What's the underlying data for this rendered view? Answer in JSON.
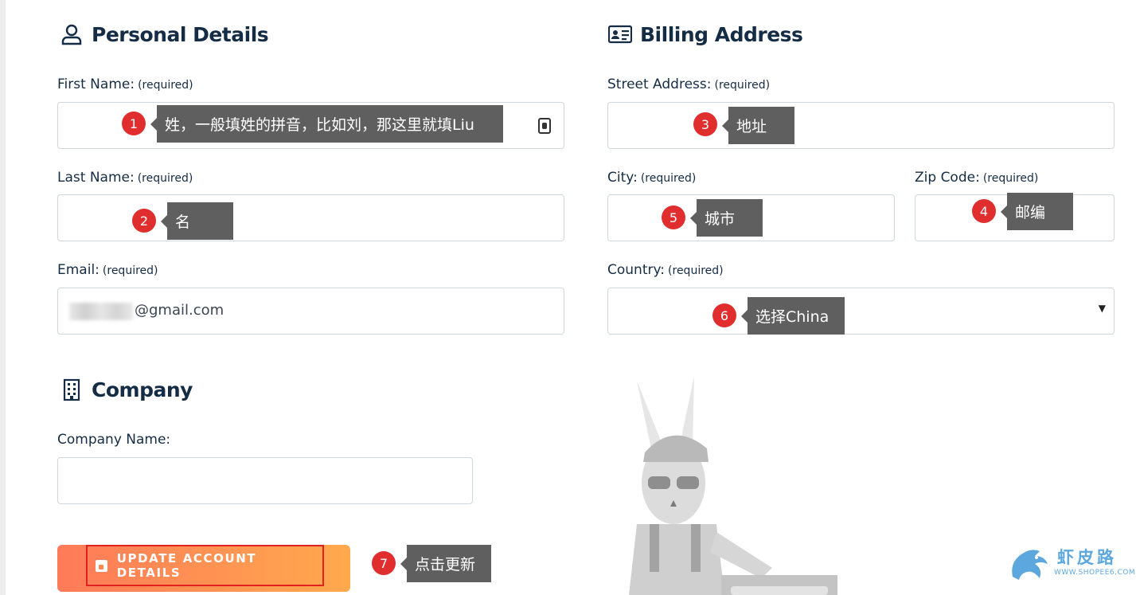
{
  "personal": {
    "title": "Personal Details",
    "first_name_label": "First Name:",
    "last_name_label": "Last Name:",
    "email_label": "Email:",
    "required": "(required)",
    "email_value": "@gmail.com"
  },
  "billing": {
    "title": "Billing Address",
    "street_label": "Street Address:",
    "city_label": "City:",
    "zip_label": "Zip Code:",
    "country_label": "Country:",
    "required": "(required)",
    "country_arrow": "▼"
  },
  "company": {
    "title": "Company",
    "name_label": "Company Name:"
  },
  "button": {
    "label": "UPDATE ACCOUNT DETAILS"
  },
  "annotations": [
    {
      "num": "1",
      "text": "姓，一般填姓的拼音，比如刘，那这里就填Liu"
    },
    {
      "num": "2",
      "text": "名"
    },
    {
      "num": "3",
      "text": "地址"
    },
    {
      "num": "4",
      "text": "邮编"
    },
    {
      "num": "5",
      "text": "城市"
    },
    {
      "num": "6",
      "text": "选择China"
    },
    {
      "num": "7",
      "text": "点击更新"
    }
  ],
  "watermark": {
    "name": "虾皮路",
    "url": "WWW.SHOPEE6.COM"
  },
  "colors": {
    "heading": "#152c45",
    "badge": "#e02d2d",
    "tooltip": "#5f5f5f",
    "button_start": "#ff7a59",
    "button_end": "#ffa94d",
    "highlight_border": "#e12020"
  }
}
